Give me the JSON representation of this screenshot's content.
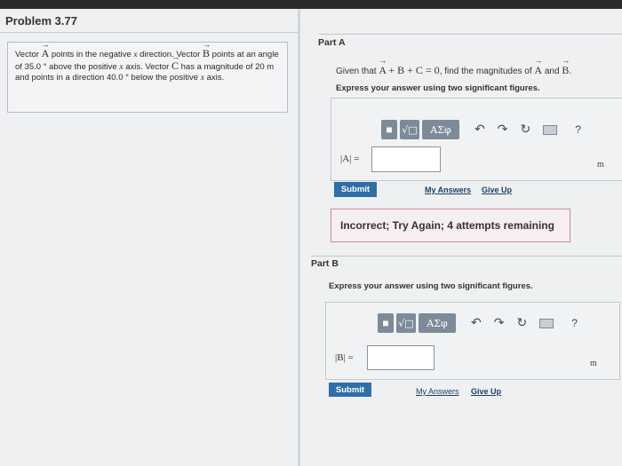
{
  "problem": {
    "title": "Problem 3.77",
    "segments": [
      {
        "t": "text",
        "v": "Vector "
      },
      {
        "t": "vec",
        "v": "A"
      },
      {
        "t": "text",
        "v": " points in the negative "
      },
      {
        "t": "var",
        "v": "x"
      },
      {
        "t": "text",
        "v": " direction. Vector "
      },
      {
        "t": "vec",
        "v": "B"
      },
      {
        "t": "text",
        "v": " points at an angle of 35.0 ° above the positive "
      },
      {
        "t": "var",
        "v": "x"
      },
      {
        "t": "text",
        "v": " axis. Vector "
      },
      {
        "t": "vec",
        "v": "C"
      },
      {
        "t": "text",
        "v": " has a magnitude of 20 m and points in a direction 40.0 ° below the positive "
      },
      {
        "t": "var",
        "v": "x"
      },
      {
        "t": "text",
        "v": " axis."
      }
    ]
  },
  "partA": {
    "label": "Part A",
    "question_prefix": "Given that ",
    "equation": "A + B + C = 0",
    "question_mid": ", find the magnitudes of ",
    "vec1": "A",
    "and_text": " and ",
    "vec2": "B",
    "period": ".",
    "instruction": "Express your answer using two significant figures.",
    "input_label": "|A| =",
    "input_value": "",
    "unit": "m",
    "submit": "Submit",
    "my_answers": "My Answers",
    "give_up": "Give Up",
    "feedback": "Incorrect; Try Again; 4 attempts remaining"
  },
  "partB": {
    "label": "Part B",
    "instruction": "Express your answer using two significant figures.",
    "input_label": "|B| =",
    "input_value": "",
    "unit": "m",
    "submit": "Submit",
    "my_answers": "My Answers",
    "give_up": "Give Up"
  },
  "toolbar": {
    "template_glyph": "■",
    "root_glyph": "√□",
    "greek_glyph": "ΑΣφ",
    "undo_glyph": "↶",
    "redo_glyph": "↷",
    "reset_glyph": "↻",
    "help_glyph": "?"
  }
}
